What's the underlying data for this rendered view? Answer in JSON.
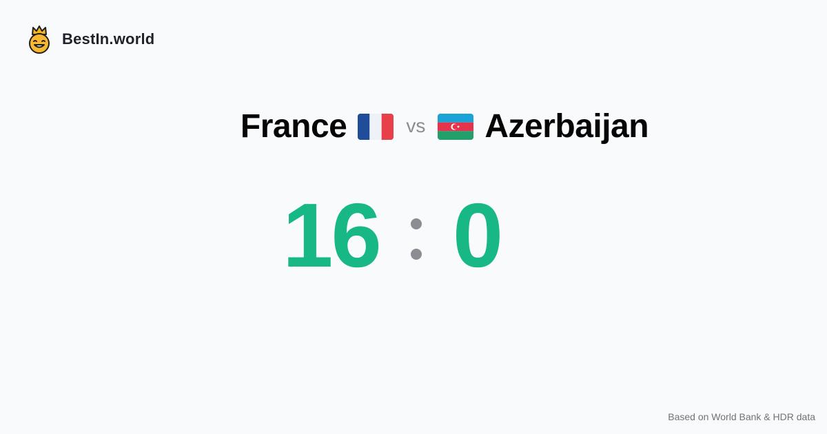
{
  "brand": {
    "name": "BestIn.world",
    "logo_icon": "crowned-smiley-icon"
  },
  "matchup": {
    "left_country": "France",
    "left_flag_icon": "france-flag-icon",
    "vs_label": "vs",
    "right_country": "Azerbaijan",
    "right_flag_icon": "azerbaijan-flag-icon"
  },
  "score": {
    "left": "16",
    "right": "0"
  },
  "footer": {
    "note": "Based on World Bank & HDR data"
  },
  "colors": {
    "background": "#f8fafc",
    "score": "#17b886",
    "muted": "#8a8d91"
  }
}
